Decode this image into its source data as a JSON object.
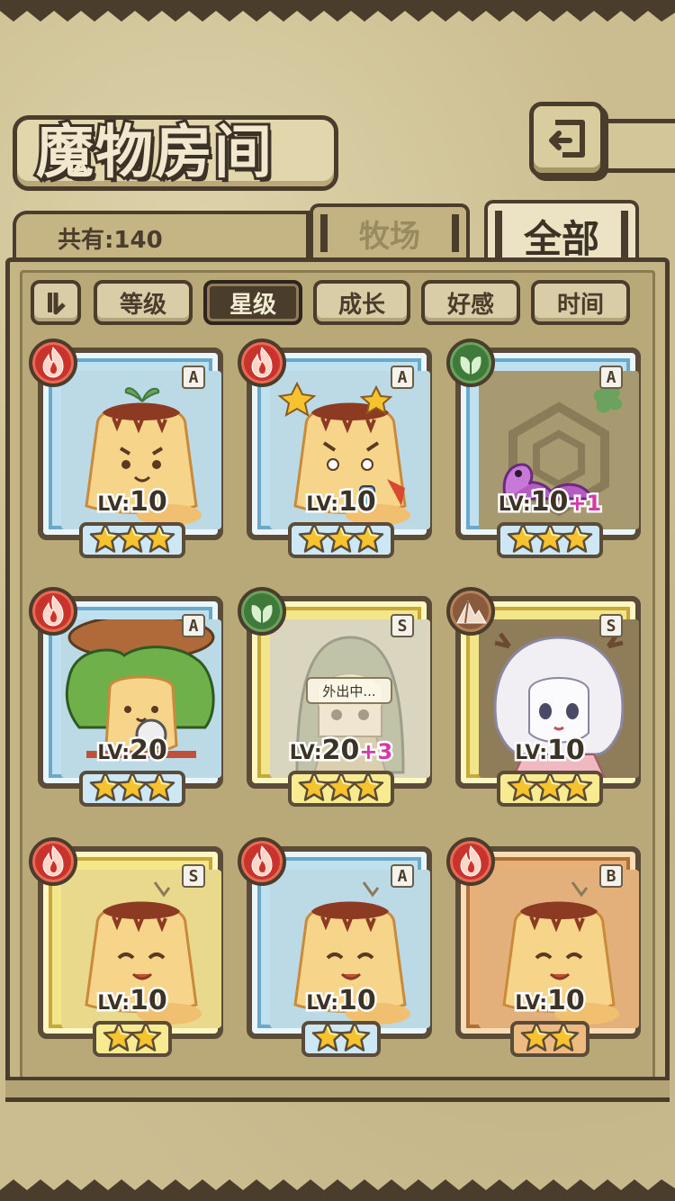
{
  "header": {
    "title": "魔物房间",
    "count_label": "共有:140"
  },
  "tabs": [
    {
      "label": "牧场",
      "active": false
    },
    {
      "label": "全部",
      "active": true
    }
  ],
  "sort": {
    "order_icon": "sort-order-icon",
    "options": [
      {
        "label": "等级",
        "active": false
      },
      {
        "label": "星级",
        "active": true
      },
      {
        "label": "成长",
        "active": false
      },
      {
        "label": "好感",
        "active": false
      },
      {
        "label": "时间",
        "active": false
      }
    ]
  },
  "monsters": [
    {
      "rank": "A",
      "element": "fire",
      "level_label": "LV:",
      "level": "10",
      "bonus": "",
      "stars": 3,
      "frame": "blue",
      "creature": "pudding-sprout",
      "status": ""
    },
    {
      "rank": "A",
      "element": "fire",
      "level_label": "LV:",
      "level": "10",
      "bonus": "",
      "stars": 3,
      "frame": "blue",
      "creature": "pudding-star",
      "status": ""
    },
    {
      "rank": "A",
      "element": "wood",
      "level_label": "LV:",
      "level": "10",
      "bonus": "+1",
      "stars": 3,
      "frame": "blue",
      "creature": "purple-worm",
      "status": ""
    },
    {
      "rank": "A",
      "element": "fire",
      "level_label": "LV:",
      "level": "20",
      "bonus": "",
      "stars": 3,
      "frame": "blue",
      "creature": "leaf-pudding",
      "status": ""
    },
    {
      "rank": "S",
      "element": "wood",
      "level_label": "LV:",
      "level": "20",
      "bonus": "+3",
      "stars": 3,
      "frame": "gold",
      "creature": "hooded-girl",
      "status": "外出中..."
    },
    {
      "rank": "S",
      "element": "earth",
      "level_label": "LV:",
      "level": "10",
      "bonus": "",
      "stars": 3,
      "frame": "gold",
      "creature": "antler-girl",
      "status": ""
    },
    {
      "rank": "S",
      "element": "fire",
      "level_label": "LV:",
      "level": "10",
      "bonus": "",
      "stars": 2,
      "frame": "gold",
      "creature": "pudding-sleepy",
      "status": ""
    },
    {
      "rank": "A",
      "element": "fire",
      "level_label": "LV:",
      "level": "10",
      "bonus": "",
      "stars": 2,
      "frame": "blue",
      "creature": "pudding-sleepy",
      "status": ""
    },
    {
      "rank": "B",
      "element": "fire",
      "level_label": "LV:",
      "level": "10",
      "bonus": "",
      "stars": 2,
      "frame": "bronze",
      "creature": "pudding-sleepy",
      "status": ""
    }
  ],
  "icons": {
    "back": "back-arrow-icon",
    "fire": "fire-element-icon",
    "wood": "leaf-element-icon",
    "earth": "mountain-element-icon",
    "star": "star-icon"
  },
  "colors": {
    "ink": "#4a3d2c",
    "parchment": "#cbbd90",
    "fire": "#c8332b",
    "wood": "#3f7a3a",
    "earth": "#8a5a3c",
    "bonus": "#d63aa8"
  }
}
